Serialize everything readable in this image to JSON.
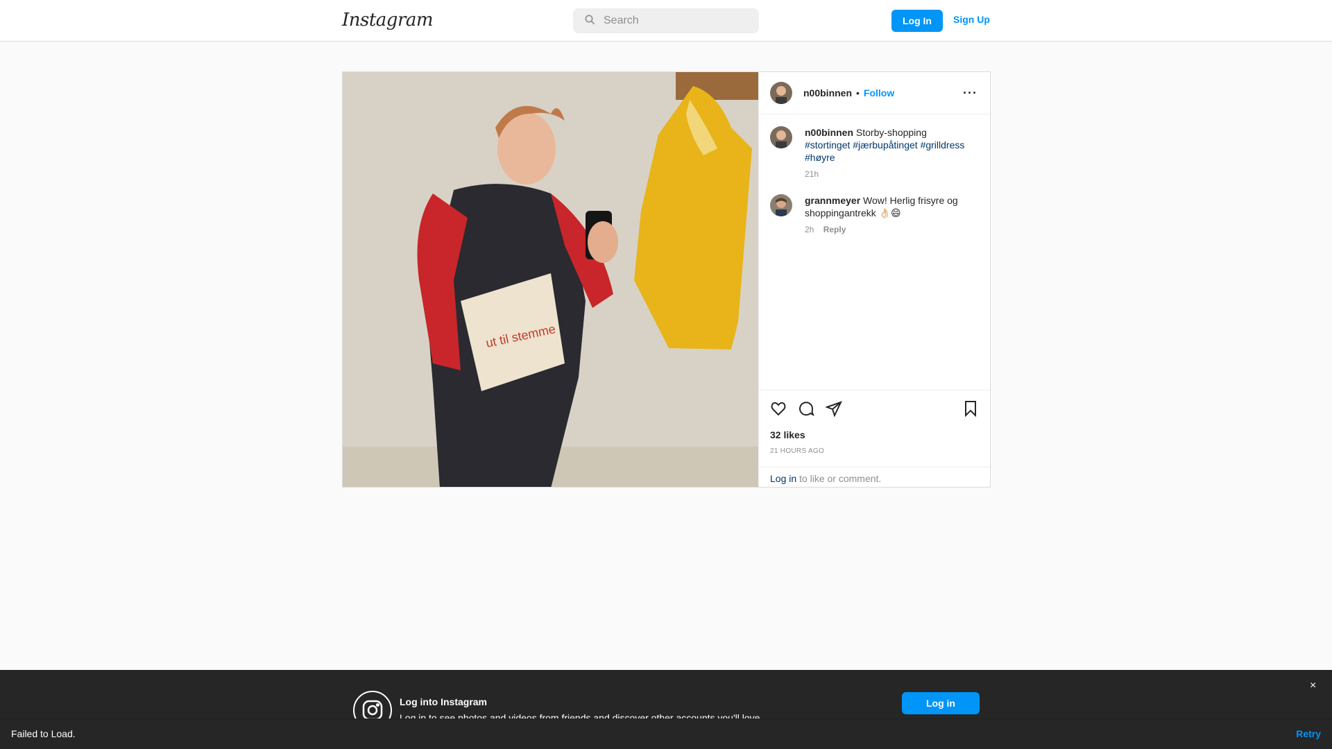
{
  "nav": {
    "logo": "Instagram",
    "search_placeholder": "Search",
    "login_label": "Log In",
    "signup_label": "Sign Up"
  },
  "post": {
    "username": "n00binnen",
    "follow_label": "Follow",
    "caption_user": "n00binnen",
    "caption_text": "Storby-shopping",
    "hashtags": [
      "#stortinget",
      "#jærbupåtinget",
      "#grilldress",
      "#høyre"
    ],
    "caption_time": "21h",
    "comment": {
      "user": "grannmeyer",
      "text": "Wow! Herlig frisyre og shoppingantrekk 👌🏻😄",
      "time": "2h",
      "reply_label": "Reply"
    },
    "likes": "32 likes",
    "time_ago": "21 HOURS AGO",
    "login_link": "Log in",
    "login_suffix": " to like or comment."
  },
  "banner": {
    "title": "Log into Instagram",
    "subtitle": "Log in to see photos and videos from friends and discover other accounts you'll love.",
    "button": "Log in",
    "close": "×"
  },
  "toast": {
    "message": "Failed to Load.",
    "retry": "Retry"
  },
  "colors": {
    "accent": "#0095f6",
    "hashtag": "#00376b",
    "banner_bg": "#262626"
  }
}
